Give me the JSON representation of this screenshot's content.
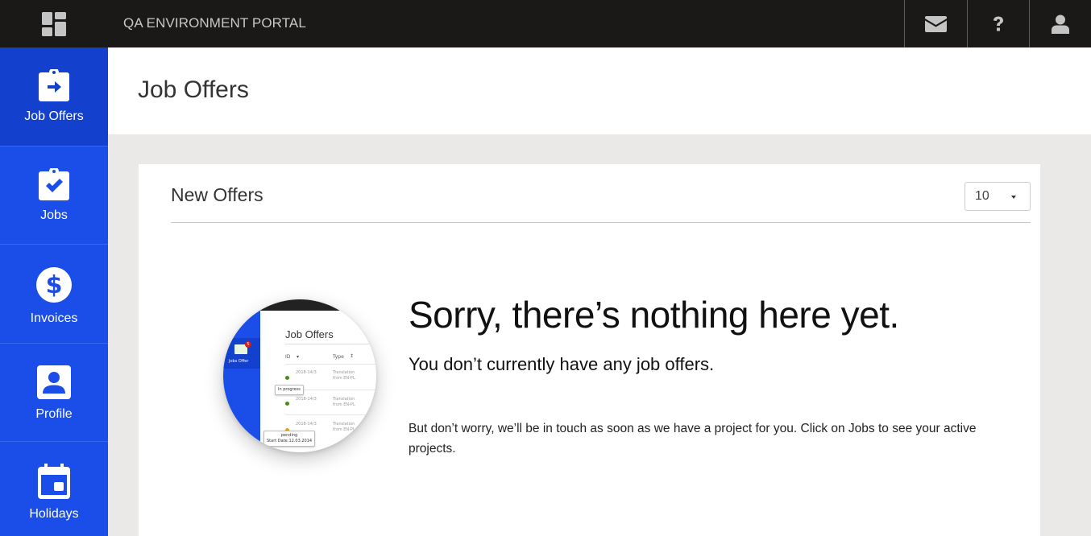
{
  "topbar": {
    "app_title": "QA ENVIRONMENT PORTAL",
    "logo_icon": "dashboard-tiles-icon",
    "buttons": [
      {
        "name": "messages",
        "icon": "envelope-icon"
      },
      {
        "name": "help",
        "icon": "question-mark-icon"
      },
      {
        "name": "account",
        "icon": "user-icon"
      }
    ]
  },
  "sidebar": {
    "items": [
      {
        "label": "Job Offers",
        "icon": "clipboard-arrow-icon",
        "active": true
      },
      {
        "label": "Jobs",
        "icon": "clipboard-check-icon",
        "active": false
      },
      {
        "label": "Invoices",
        "icon": "dollar-circle-icon",
        "active": false
      },
      {
        "label": "Profile",
        "icon": "profile-card-icon",
        "active": false
      },
      {
        "label": "Holidays",
        "icon": "calendar-icon",
        "active": false
      }
    ]
  },
  "page": {
    "title": "Job Offers"
  },
  "card": {
    "title": "New Offers",
    "page_size": {
      "selected": "10"
    }
  },
  "empty_state": {
    "heading": "Sorry, there’s nothing here yet.",
    "subheading": "You don’t currently have any job offers.",
    "body": "But don’t worry, we’ll be in touch as soon as we have a project for you. Click on Jobs to see your active projects.",
    "illustration": {
      "panel_title": "Job Offers",
      "sidebar_label": "Jobs Offer",
      "badge_count": "5",
      "columns": [
        "ID",
        "Type"
      ],
      "rows": [
        {
          "date": "2018-14/3",
          "type": "Translation from EN-PL",
          "status_color": "#4a8a1c"
        },
        {
          "date": "2018-14/3",
          "type": "Translation from EN-PL",
          "status_color": "#4a8a1c"
        },
        {
          "date": "2018-14/3",
          "type": "Translation from EN-PL",
          "status_color": "#e0a020"
        }
      ],
      "tooltip_1": "In progress",
      "tooltip_2_line1": "pending",
      "tooltip_2_line2": "Start Date:12.03.2014"
    }
  },
  "colors": {
    "topbar_bg": "#1a1918",
    "sidebar_bg": "#1b4de8",
    "sidebar_active_bg": "#1340cc",
    "content_bg": "#eae9e7"
  }
}
